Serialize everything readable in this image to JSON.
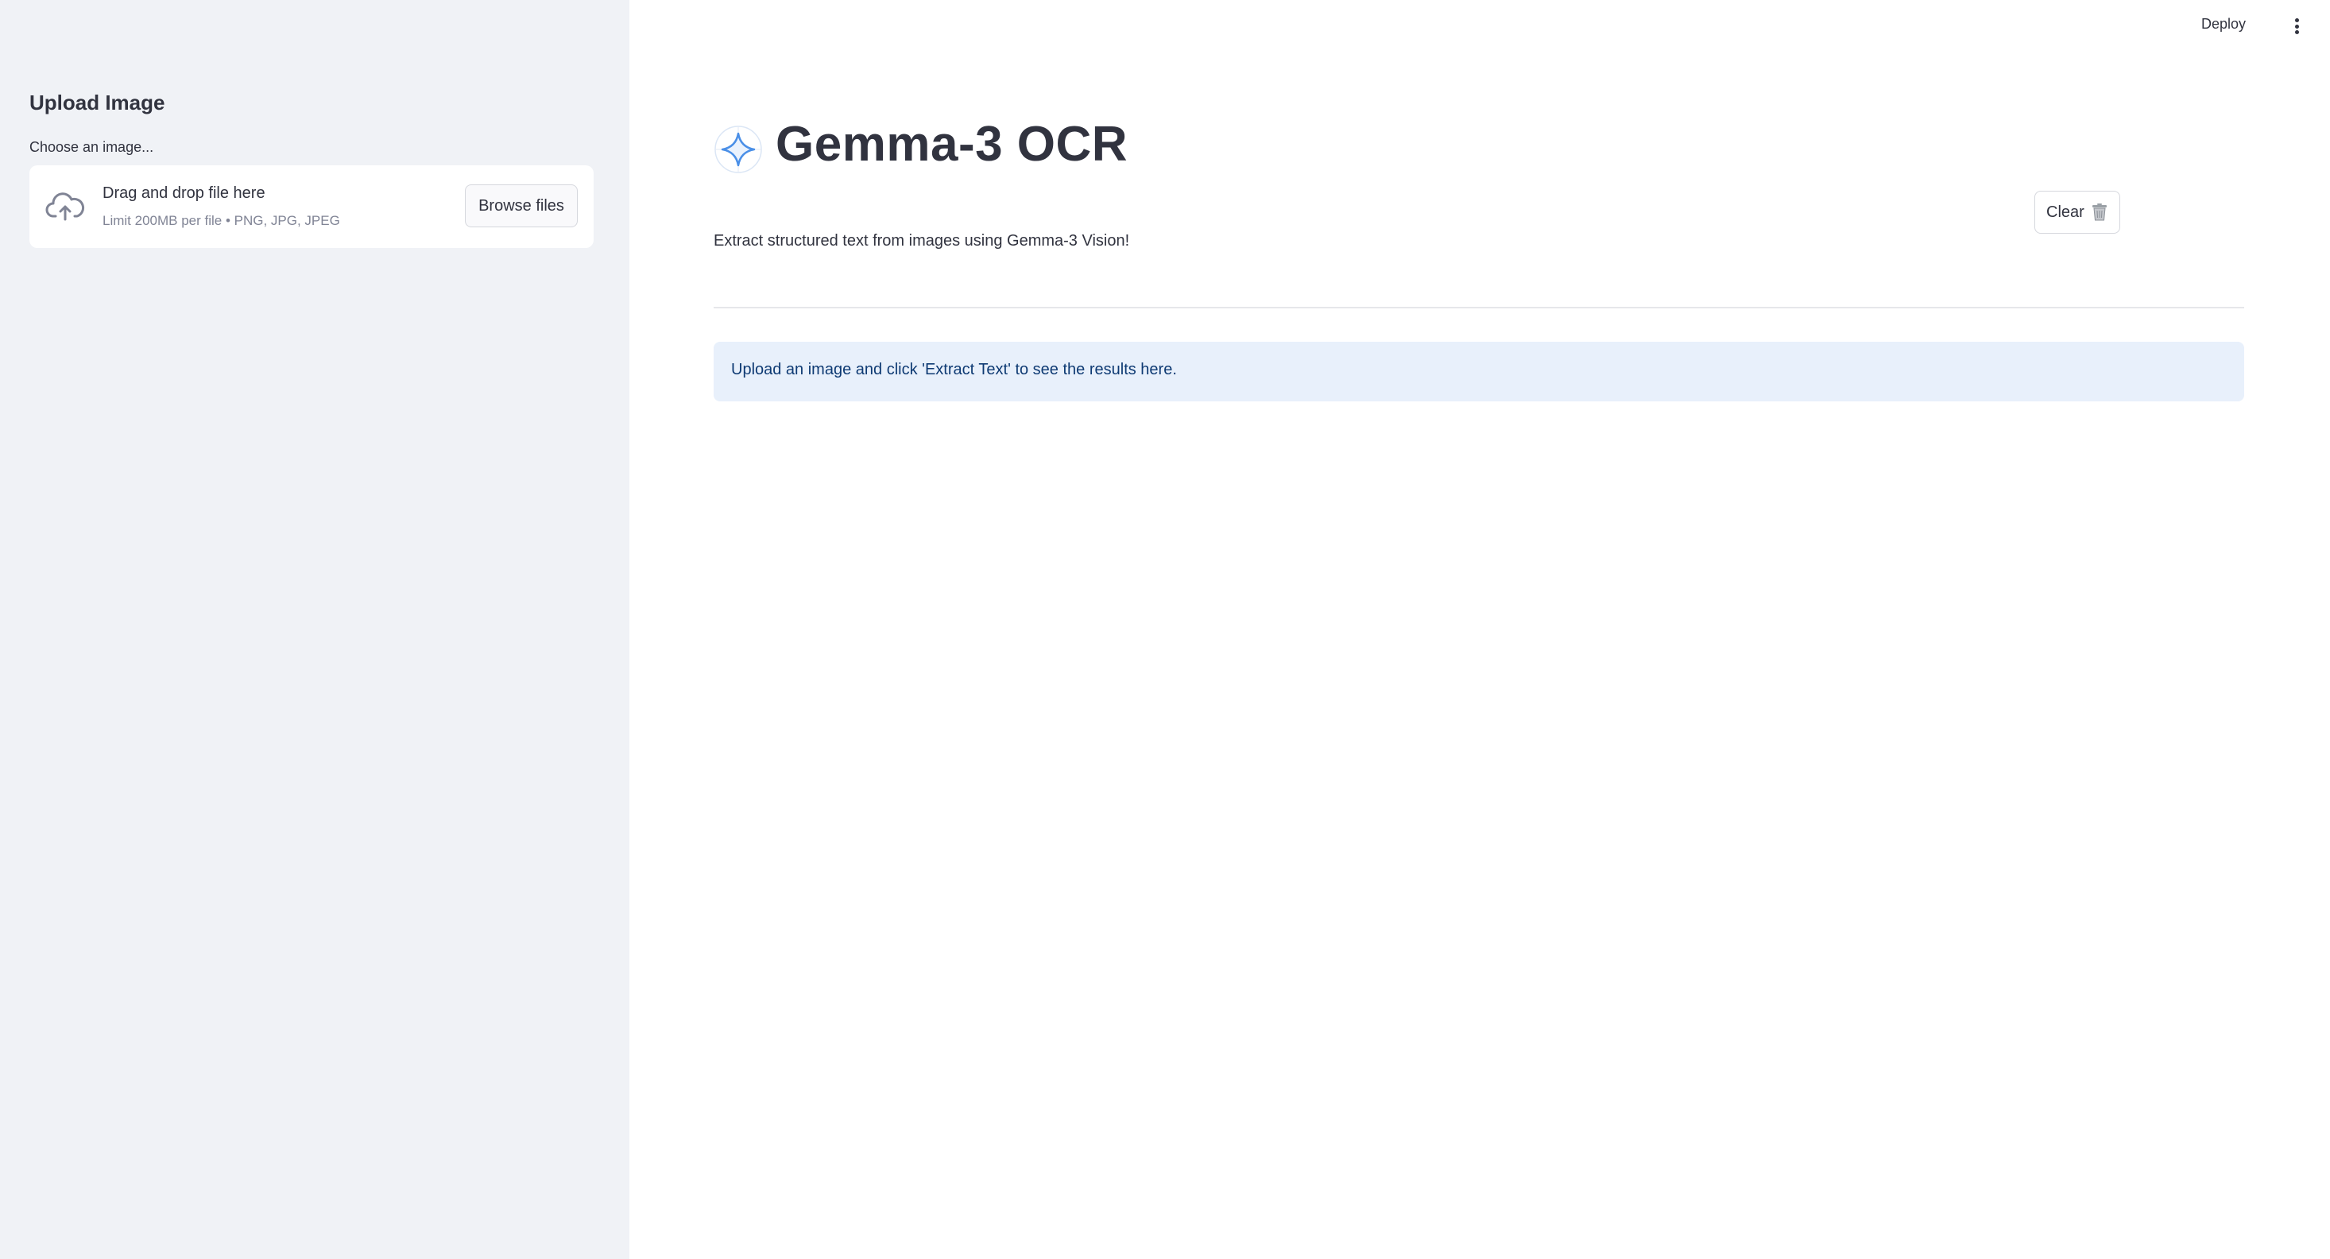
{
  "sidebar": {
    "title": "Upload Image",
    "uploader": {
      "label": "Choose an image...",
      "drop_title": "Drag and drop file here",
      "drop_subtitle": "Limit 200MB per file • PNG, JPG, JPEG",
      "browse_label": "Browse files",
      "icon": "cloud-upload-icon"
    }
  },
  "header": {
    "deploy_label": "Deploy",
    "menu_icon": "kebab-menu-icon"
  },
  "main": {
    "title": "Gemma-3 OCR",
    "title_icon": "sparkle-logo-icon",
    "subtitle": "Extract structured text from images using Gemma-3 Vision!",
    "clear_label": "Clear",
    "clear_icon": "trash-icon",
    "info_message": "Upload an image and click 'Extract Text' to see the results here."
  },
  "colors": {
    "sidebar_bg": "#f0f2f6",
    "info_bg": "#e8f0fb",
    "info_text": "#0e3a73",
    "text": "#31333f",
    "accent_blue": "#4a8fe7"
  }
}
